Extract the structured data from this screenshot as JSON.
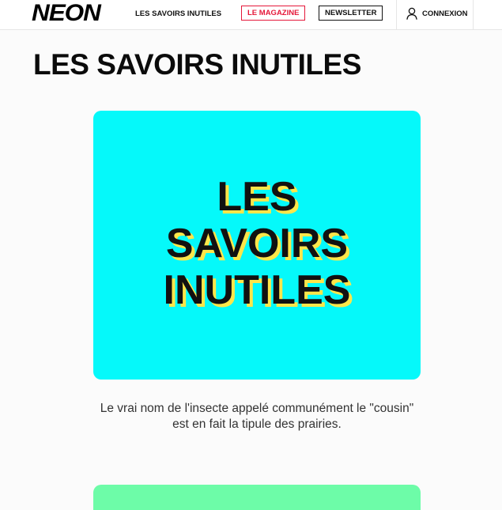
{
  "header": {
    "logo": "NEON",
    "nav_savoirs": "LES SAVOIRS INUTILES",
    "nav_magazine": "LE MAGAZINE",
    "nav_newsletter": "NEWSLETTER",
    "login_label": "CONNEXION",
    "login_icon": "user-icon"
  },
  "main": {
    "title": "LES SAVOIRS INUTILES",
    "card_image_lines": [
      "LES",
      "SAVOIRS",
      "INUTILES"
    ],
    "card_image_bg": "#05f9fa",
    "card_text_shadow": "#ffe64a",
    "caption": "Le vrai nom de l'insecte appelé communément le \"cousin\" est en fait la tipule des prairies.",
    "next_card_bg": "#6dfca8"
  },
  "colors": {
    "accent_red": "#e5183a"
  }
}
